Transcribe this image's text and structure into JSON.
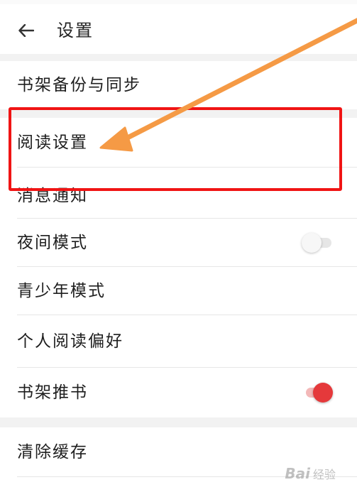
{
  "header": {
    "title": "设置"
  },
  "settings": {
    "bookshelf_backup": "书架备份与同步",
    "reading_settings": "阅读设置",
    "notifications": "消息通知",
    "night_mode": {
      "label": "夜间模式",
      "enabled": false
    },
    "teen_mode": "青少年模式",
    "personal_preferences": "个人阅读偏好",
    "bookshelf_recommend": {
      "label": "书架推书",
      "enabled": true
    },
    "clear_cache": "清除缓存"
  },
  "watermark": {
    "brand": "Bai",
    "suffix": "经验"
  },
  "colors": {
    "accent": "#e5393b",
    "highlight_box": "#f01414",
    "arrow": "#f59a45"
  }
}
